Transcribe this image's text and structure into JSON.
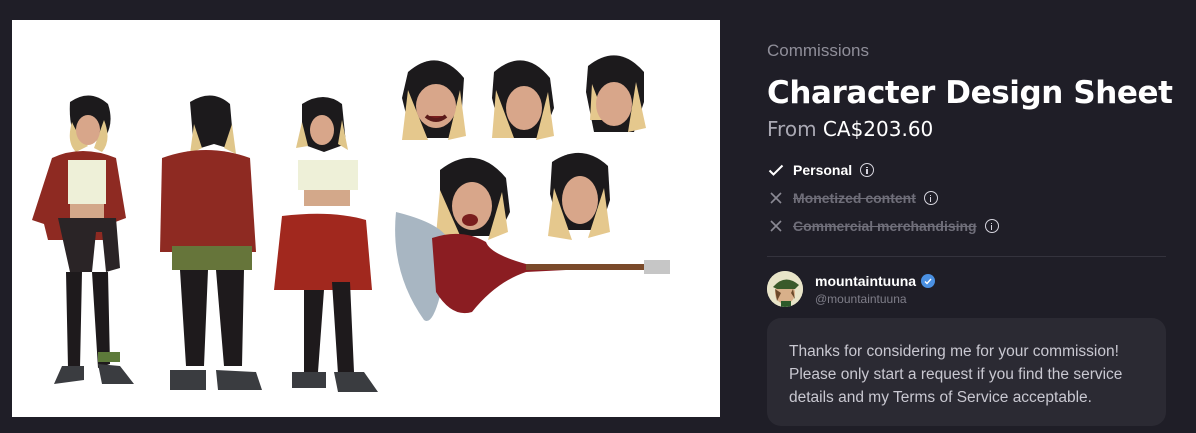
{
  "category": "Commissions",
  "title": "Character Design Sheet",
  "price": {
    "prefix": "From",
    "amount": "CA$203.60"
  },
  "usage": [
    {
      "label": "Personal",
      "allowed": true
    },
    {
      "label": "Monetized content",
      "allowed": false
    },
    {
      "label": "Commercial merchandising",
      "allowed": false
    }
  ],
  "artist": {
    "name": "mountaintuuna",
    "handle": "@mountaintuuna",
    "verified": true
  },
  "message": "Thanks for considering me for your commission! Please only start a request if you find the service details and my Terms of Service acceptable.",
  "colors": {
    "background": "#1f1e27",
    "card": "#2b2a33",
    "verified": "#4a90e2",
    "accent_red": "#9a2a22"
  },
  "icons": [
    "check-icon",
    "cross-icon",
    "info-icon",
    "verified-badge-icon"
  ]
}
